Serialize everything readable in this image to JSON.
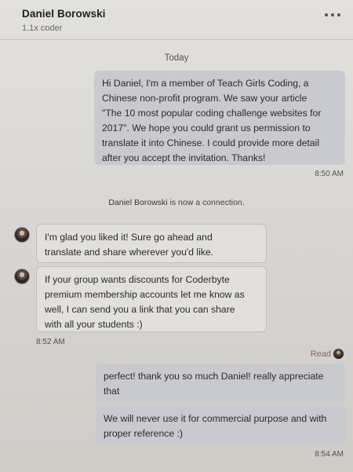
{
  "header": {
    "name": "Daniel Borowski",
    "headline": "1.1x coder"
  },
  "conversation": {
    "date_divider": "Today",
    "messages": [
      {
        "text": "Hi Daniel, I'm a member of Teach Girls Coding, a\nChinese non-profit program. We saw your article\n\"The 10 most popular coding challenge websites for\n2017\". We hope you could grant us permission to\ntranslate it into Chinese. I could provide more detail\nafter you accept the invitation. Thanks!",
        "time": "8:50 AM"
      },
      {
        "text": "I'm glad you liked it! Sure go ahead and\ntranslate and share wherever you'd like."
      },
      {
        "text": "If your group wants discounts for Coderbyte\npremium membership accounts let me know as\nwell, I can send you a link that you can share\nwith all your students :)",
        "time": "8:52 AM"
      },
      {
        "text": "perfect! thank you so much Daniel! really appreciate\nthat"
      },
      {
        "text": "We will never use it for commercial purpose and with\nproper reference :)",
        "time": "8:54 AM"
      }
    ],
    "connection_notice": {
      "name": "Daniel Borowski",
      "suffix": " is now a connection."
    },
    "read_label": "Read"
  },
  "icons": {
    "more": "more-horizontal-icon",
    "read_receipt": "read-receipt-avatar-icon"
  }
}
